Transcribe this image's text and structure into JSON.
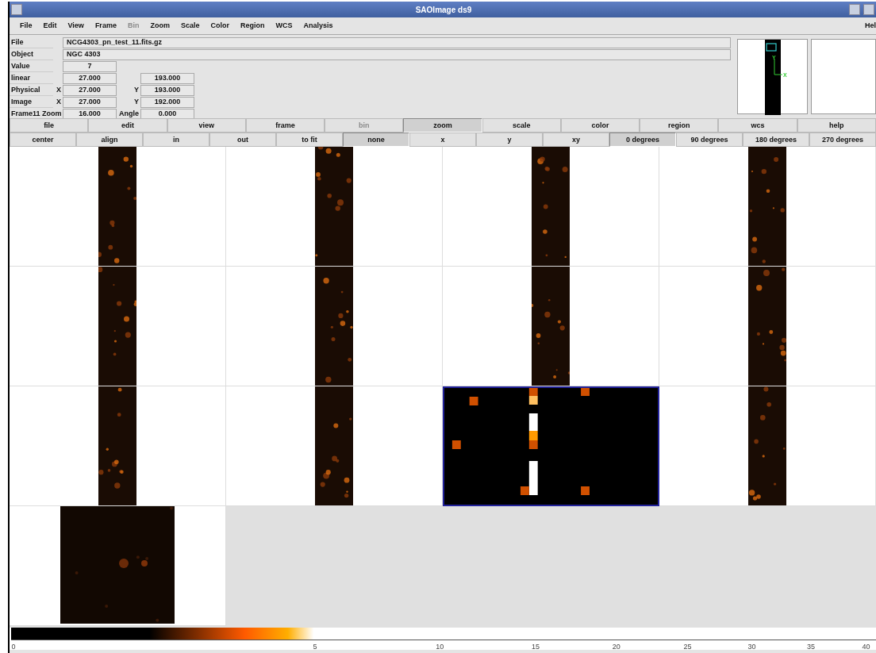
{
  "window": {
    "title": "SAOImage ds9"
  },
  "menu": [
    {
      "label": "File",
      "disabled": false
    },
    {
      "label": "Edit",
      "disabled": false
    },
    {
      "label": "View",
      "disabled": false
    },
    {
      "label": "Frame",
      "disabled": false
    },
    {
      "label": "Bin",
      "disabled": true
    },
    {
      "label": "Zoom",
      "disabled": false
    },
    {
      "label": "Scale",
      "disabled": false
    },
    {
      "label": "Color",
      "disabled": false
    },
    {
      "label": "Region",
      "disabled": false
    },
    {
      "label": "WCS",
      "disabled": false
    },
    {
      "label": "Analysis",
      "disabled": false
    }
  ],
  "help_menu": "Hel",
  "info": [
    {
      "kind": "wide",
      "label": "File",
      "value": "NCG4303_pn_test_11.fits.gz"
    },
    {
      "kind": "wide",
      "label": "Object",
      "value": "NGC 4303"
    },
    {
      "kind": "single",
      "label": "Value",
      "value": "7"
    },
    {
      "kind": "pair",
      "label": "linear",
      "value": "27.000",
      "value2": "193.000"
    },
    {
      "kind": "coord",
      "label": "Physical",
      "axis": "X",
      "value": "27.000",
      "axis2": "Y",
      "value2": "193.000"
    },
    {
      "kind": "coord",
      "label": "Image",
      "axis": "X",
      "value": "27.000",
      "axis2": "Y",
      "value2": "192.000"
    },
    {
      "kind": "zoom",
      "label": "Frame11 Zoom",
      "value": "16.000",
      "axis2": "Angle",
      "value2": "0.000"
    }
  ],
  "panner": {
    "compass_labels": [
      "Y",
      "X"
    ]
  },
  "buttons_top": [
    {
      "label": "file",
      "selected": false,
      "disabled": false
    },
    {
      "label": "edit",
      "selected": false,
      "disabled": false
    },
    {
      "label": "view",
      "selected": false,
      "disabled": false
    },
    {
      "label": "frame",
      "selected": false,
      "disabled": false
    },
    {
      "label": "bin",
      "selected": false,
      "disabled": true
    },
    {
      "label": "zoom",
      "selected": true,
      "disabled": false
    },
    {
      "label": "scale",
      "selected": false,
      "disabled": false
    },
    {
      "label": "color",
      "selected": false,
      "disabled": false
    },
    {
      "label": "region",
      "selected": false,
      "disabled": false
    },
    {
      "label": "wcs",
      "selected": false,
      "disabled": false
    },
    {
      "label": "help",
      "selected": false,
      "disabled": false
    }
  ],
  "buttons_bottom": [
    {
      "label": "center",
      "selected": false
    },
    {
      "label": "align",
      "selected": false
    },
    {
      "label": "in",
      "selected": false
    },
    {
      "label": "out",
      "selected": false
    },
    {
      "label": "to fit",
      "selected": false
    },
    {
      "label": "none",
      "selected": true
    },
    {
      "label": "x",
      "selected": false
    },
    {
      "label": "y",
      "selected": false
    },
    {
      "label": "xy",
      "selected": false
    },
    {
      "label": "0 degrees",
      "selected": true
    },
    {
      "label": "90 degrees",
      "selected": false
    },
    {
      "label": "180 degrees",
      "selected": false
    },
    {
      "label": "270 degrees",
      "selected": false
    }
  ],
  "frames": [
    {
      "kind": "strip",
      "selected": false
    },
    {
      "kind": "strip",
      "selected": false
    },
    {
      "kind": "strip",
      "selected": false
    },
    {
      "kind": "strip",
      "selected": false
    },
    {
      "kind": "strip",
      "selected": false
    },
    {
      "kind": "strip",
      "selected": false
    },
    {
      "kind": "strip",
      "selected": false
    },
    {
      "kind": "strip",
      "selected": false
    },
    {
      "kind": "strip",
      "selected": false
    },
    {
      "kind": "strip",
      "selected": false
    },
    {
      "kind": "zoomed",
      "selected": true
    },
    {
      "kind": "strip",
      "selected": false
    },
    {
      "kind": "square",
      "selected": false
    }
  ],
  "colorbar": {
    "ticks": [
      "0",
      "5",
      "10",
      "15",
      "20",
      "25",
      "30",
      "35",
      "40"
    ]
  }
}
